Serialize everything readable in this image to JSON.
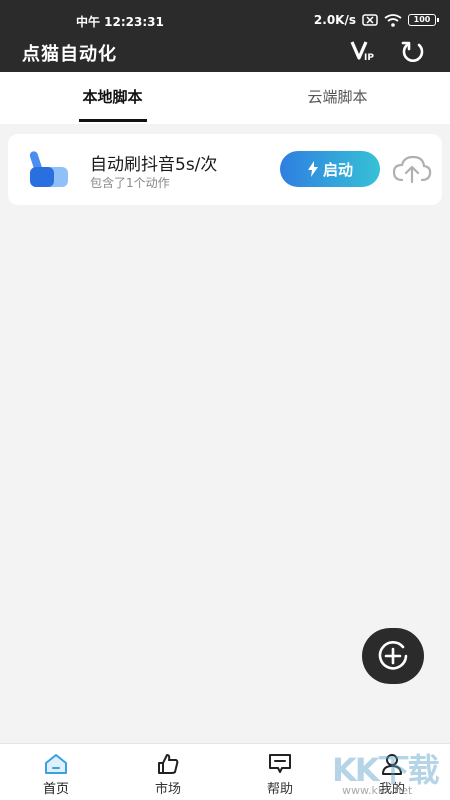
{
  "status_bar": {
    "time": "中午 12:23:31",
    "speed": "2.0K/s",
    "battery": "100"
  },
  "app": {
    "title": "点猫自动化"
  },
  "tabs": [
    {
      "label": "本地脚本",
      "active": true
    },
    {
      "label": "云端脚本",
      "active": false
    }
  ],
  "scripts": [
    {
      "title": "自动刷抖音5s/次",
      "subtitle": "包含了1个动作",
      "start_label": "启动"
    }
  ],
  "nav": [
    {
      "label": "首页",
      "icon": "home-icon",
      "active": true
    },
    {
      "label": "市场",
      "icon": "thumbs-up-icon",
      "active": false
    },
    {
      "label": "帮助",
      "icon": "message-icon",
      "active": false
    },
    {
      "label": "我的",
      "icon": "user-icon",
      "active": false
    }
  ],
  "watermark": {
    "logo": "KK下载",
    "url": "www.kkx.net"
  },
  "colors": {
    "topbar": "#2b2b2b",
    "accent_start": "#2f7fe0",
    "accent_end": "#36c1d6",
    "home_icon": "#3aa0e0"
  }
}
